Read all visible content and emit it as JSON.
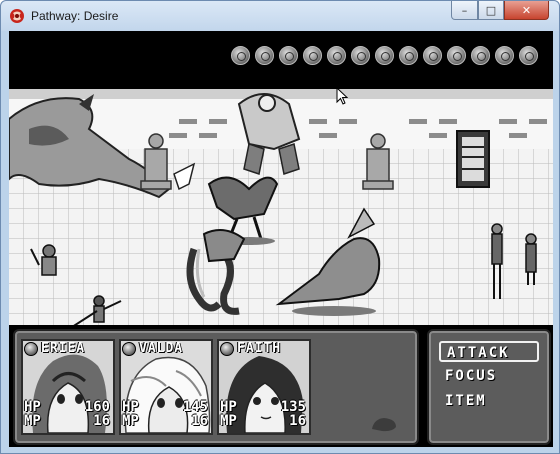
{
  "window": {
    "title": "Pathway: Desire",
    "minimize_glyph": "–",
    "maximize_glyph": "□",
    "close_glyph": "✕"
  },
  "turn_order": {
    "orb_count": 13,
    "icon": "turn-orb-icon"
  },
  "party": [
    {
      "name": "ERIEA",
      "hp_label": "HP",
      "hp": "160",
      "mp_label": "MP",
      "mp": "16"
    },
    {
      "name": "VALDA",
      "hp_label": "HP",
      "hp": "145",
      "mp_label": "MP",
      "mp": "16"
    },
    {
      "name": "FAITH",
      "hp_label": "HP",
      "hp": "135",
      "mp_label": "MP",
      "mp": "16"
    }
  ],
  "command_menu": {
    "items": [
      "ATTACK",
      "FOCUS",
      "ITEM"
    ],
    "selected": "ATTACK"
  },
  "colors": {
    "titlebar": "#c2d6ec",
    "close_button": "#c7442f",
    "panel": "#5c5c5c",
    "battlefield_floor": "#f1f1f1"
  }
}
